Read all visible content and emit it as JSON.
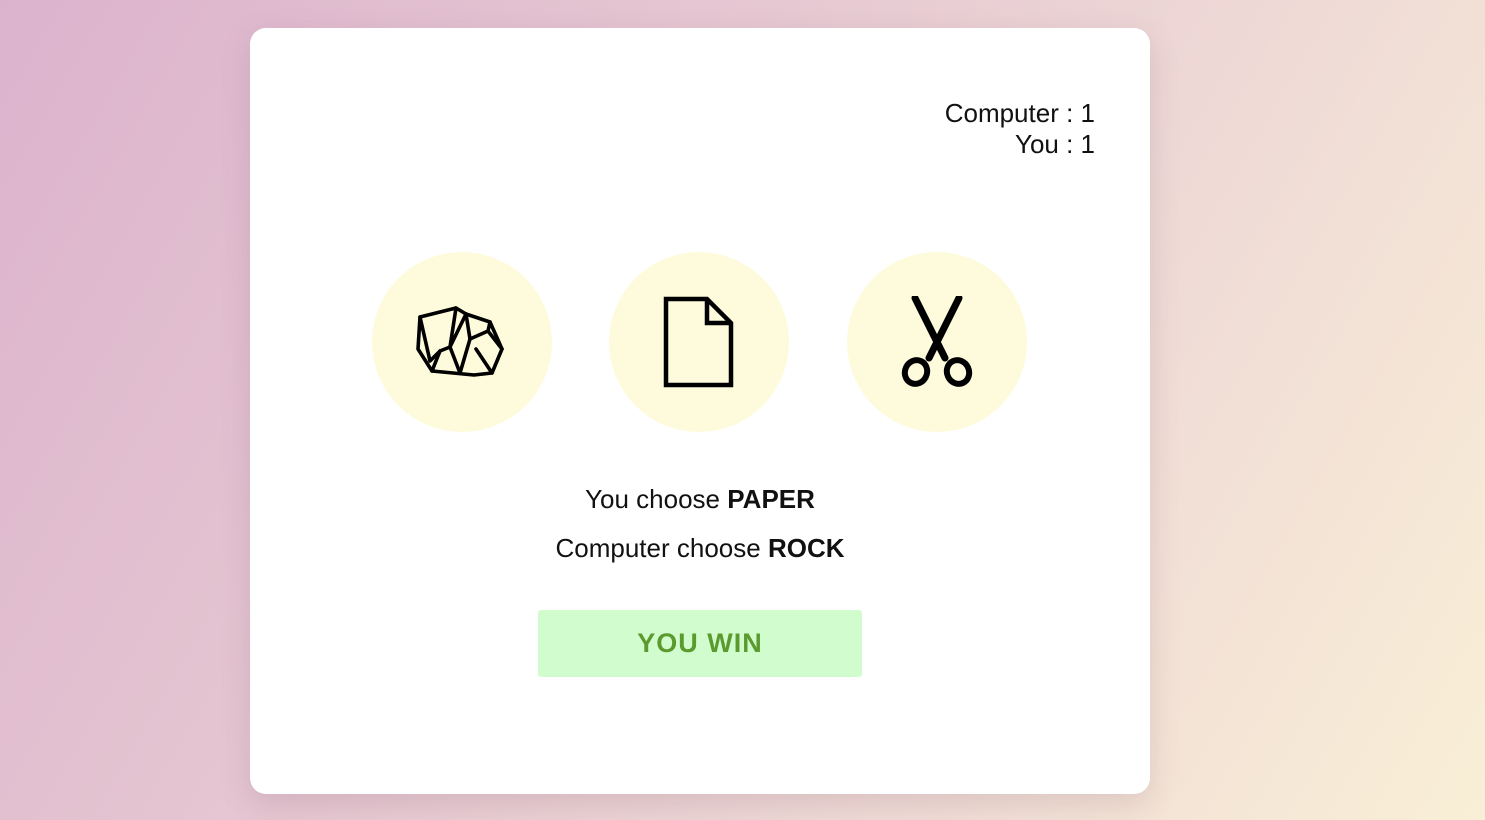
{
  "scoreboard": {
    "computer_label": "Computer",
    "computer_score": "1",
    "you_label": "You",
    "you_score": "1"
  },
  "choices": [
    {
      "name": "rock",
      "icon": "rock-icon"
    },
    {
      "name": "paper",
      "icon": "paper-icon"
    },
    {
      "name": "scissors",
      "icon": "scissors-icon"
    }
  ],
  "result": {
    "you_prefix": "You choose",
    "you_choice": "PAPER",
    "computer_prefix": "Computer choose",
    "computer_choice": "ROCK",
    "outcome": "YOU WIN"
  },
  "colors": {
    "choice_bg": "#fefbdc",
    "outcome_bg": "#d1fccd",
    "outcome_text": "#5b9a2e"
  }
}
